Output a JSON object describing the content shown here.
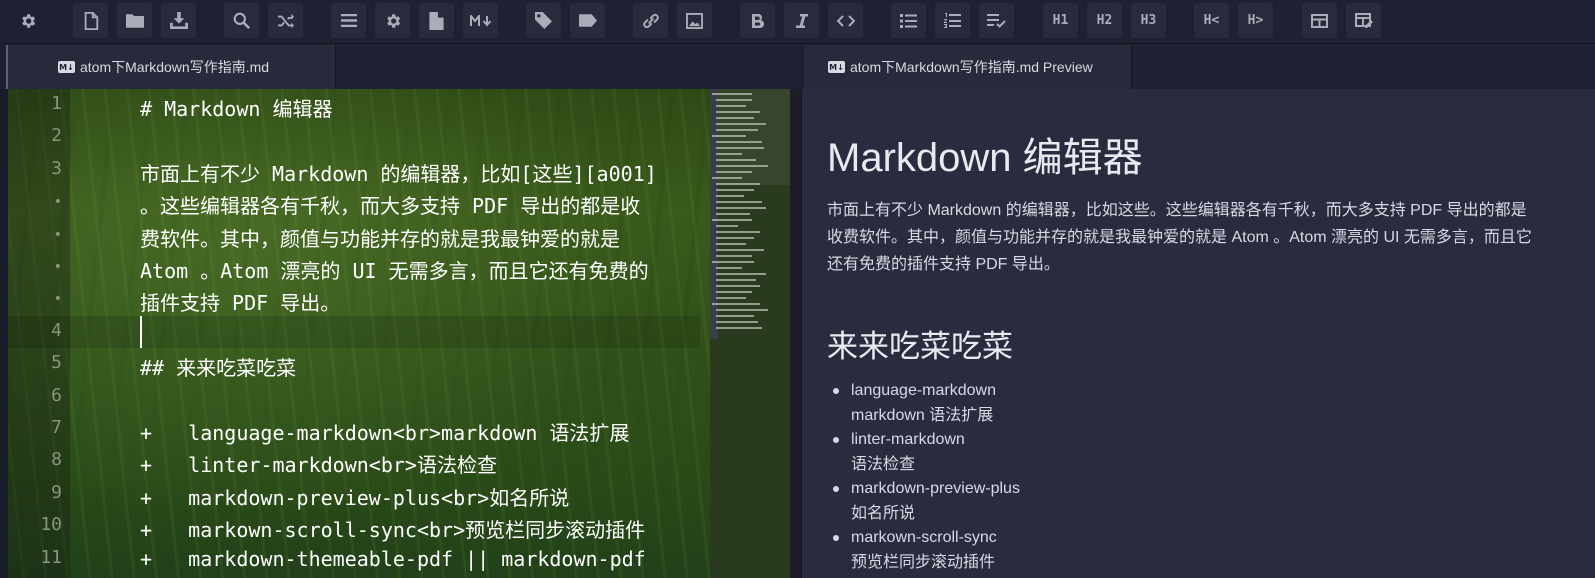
{
  "toolbar": {
    "buttons": [
      {
        "name": "settings-button",
        "icon": "gear-icon"
      },
      {
        "name": "new-file-button",
        "icon": "file-icon"
      },
      {
        "name": "open-folder-button",
        "icon": "folder-icon"
      },
      {
        "name": "save-button",
        "icon": "download-icon"
      },
      {
        "name": "find-button",
        "icon": "search-icon"
      },
      {
        "name": "shuffle-button",
        "icon": "shuffle-icon"
      },
      {
        "name": "menu-button",
        "icon": "hamburger-icon"
      },
      {
        "name": "preferences-button",
        "icon": "gear-icon"
      },
      {
        "name": "document-button",
        "icon": "document-icon"
      },
      {
        "name": "markdown-preview-button",
        "icon": "markdown-icon"
      },
      {
        "name": "tag-button",
        "icon": "tag-icon"
      },
      {
        "name": "label-button",
        "icon": "label-icon"
      },
      {
        "name": "link-button",
        "icon": "link-icon"
      },
      {
        "name": "image-button",
        "icon": "image-icon"
      },
      {
        "name": "bold-button",
        "icon": "bold-icon"
      },
      {
        "name": "italic-button",
        "icon": "italic-icon"
      },
      {
        "name": "code-button",
        "icon": "code-icon"
      },
      {
        "name": "bullet-list-button",
        "icon": "bullet-list-icon"
      },
      {
        "name": "numbered-list-button",
        "icon": "numbered-list-icon"
      },
      {
        "name": "task-list-button",
        "icon": "task-list-icon"
      }
    ],
    "heading_labels": {
      "h1": "H1",
      "h2": "H2",
      "h3": "H3"
    },
    "indent_labels": {
      "outdent": "H<",
      "indent": "H>"
    },
    "extra_buttons": [
      {
        "name": "table-button",
        "icon": "table-icon"
      },
      {
        "name": "format-table-button",
        "icon": "edit-table-icon"
      }
    ]
  },
  "tabs": {
    "editor_tab": "atom下Markdown写作指南.md",
    "preview_tab": "atom下Markdown写作指南.md Preview",
    "badge": "M↓"
  },
  "editor": {
    "lines": [
      {
        "number": "1",
        "text": "# Markdown 编辑器"
      },
      {
        "number": "2",
        "text": ""
      },
      {
        "number": "3",
        "text": "市面上有不少 Markdown 的编辑器，比如[这些][a001]"
      },
      {
        "number": "•",
        "text": "。这些编辑器各有千秋，而大多支持 PDF 导出的都是收"
      },
      {
        "number": "•",
        "text": "费软件。其中，颜值与功能并存的就是我最钟爱的就是"
      },
      {
        "number": "•",
        "text": "Atom 。Atom 漂亮的 UI 无需多言，而且它还有免费的"
      },
      {
        "number": "•",
        "text": "插件支持 PDF 导出。"
      },
      {
        "number": "4",
        "text": ""
      },
      {
        "number": "5",
        "text": "## 来来吃菜吃菜"
      },
      {
        "number": "6",
        "text": ""
      },
      {
        "number": "7",
        "text": "+   language-markdown<br>markdown 语法扩展"
      },
      {
        "number": "8",
        "text": "+   linter-markdown<br>语法检查"
      },
      {
        "number": "9",
        "text": "+   markdown-preview-plus<br>如名所说"
      },
      {
        "number": "10",
        "text": "+   markown-scroll-sync<br>预览栏同步滚动插件"
      },
      {
        "number": "11",
        "text": "+   markdown-themeable-pdf || markdown-pdf"
      }
    ]
  },
  "preview": {
    "h1": "Markdown 编辑器",
    "paragraph": "市面上有不少 Markdown 的编辑器，比如这些。这些编辑器各有千秋，而大多支持 PDF 导出的都是收费软件。其中，颜值与功能并存的就是我最钟爱的就是 Atom 。Atom 漂亮的 UI 无需多言，而且它还有免费的插件支持 PDF 导出。",
    "h2": "来来吃菜吃菜",
    "list": [
      {
        "name": "language-markdown",
        "desc": "markdown 语法扩展"
      },
      {
        "name": "linter-markdown",
        "desc": "语法检查"
      },
      {
        "name": "markdown-preview-plus",
        "desc": "如名所说"
      },
      {
        "name": "markown-scroll-sync",
        "desc": "预览栏同步滚动插件"
      }
    ]
  }
}
